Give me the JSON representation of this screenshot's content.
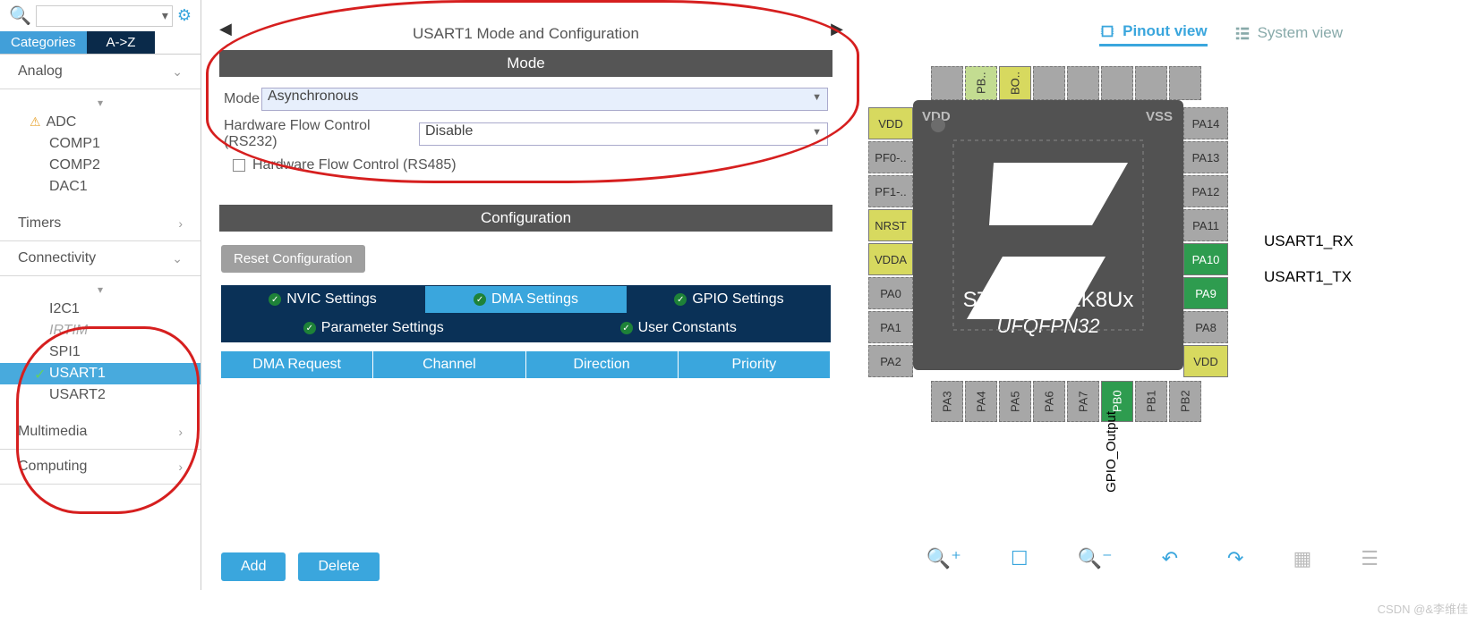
{
  "sidebar": {
    "tabs": {
      "categories": "Categories",
      "az": "A->Z"
    },
    "groups": [
      {
        "name": "Analog",
        "items": [
          "ADC",
          "COMP1",
          "COMP2",
          "DAC1"
        ],
        "open": true
      },
      {
        "name": "Timers",
        "items": [],
        "open": false
      },
      {
        "name": "Connectivity",
        "items": [
          "I2C1",
          "IRTIM",
          "SPI1",
          "USART1",
          "USART2"
        ],
        "open": true
      },
      {
        "name": "Multimedia",
        "items": [],
        "open": false
      },
      {
        "name": "Computing",
        "items": [],
        "open": false
      }
    ]
  },
  "center": {
    "title": "USART1 Mode and Configuration",
    "modeHeader": "Mode",
    "modeLabel": "Mode",
    "modeValue": "Asynchronous",
    "hwLabel": "Hardware Flow Control (RS232)",
    "hwValue": "Disable",
    "chk485": "Hardware Flow Control (RS485)",
    "configHeader": "Configuration",
    "reset": "Reset Configuration",
    "tabs1": [
      "NVIC Settings",
      "DMA Settings",
      "GPIO Settings"
    ],
    "tabs2": [
      "Parameter Settings",
      "User Constants"
    ],
    "dmaCols": [
      "DMA Request",
      "Channel",
      "Direction",
      "Priority"
    ],
    "add": "Add",
    "delete": "Delete"
  },
  "right": {
    "pinout": "Pinout view",
    "system": "System view",
    "chipName": "STM32F051K8Ux",
    "chipPkg": "UFQFPN32",
    "vdd": "VDD",
    "vss": "VSS",
    "leftPins": [
      "VDD",
      "PF0-..",
      "PF1-..",
      "NRST",
      "VDDA",
      "PA0",
      "PA1",
      "PA2"
    ],
    "rightPins": [
      "PA14",
      "PA13",
      "PA12",
      "PA11",
      "PA10",
      "PA9",
      "PA8",
      "VDD"
    ],
    "topPins": [
      "",
      "PB..",
      "BO..",
      "",
      "",
      "",
      "",
      ""
    ],
    "botPins": [
      "PA3",
      "PA4",
      "PA5",
      "PA6",
      "PA7",
      "PB0",
      "PB1",
      "PB2"
    ],
    "usartRx": "USART1_RX",
    "usartTx": "USART1_TX",
    "gpioOut": "GPIO_Output"
  },
  "watermark": "CSDN @&李维佳"
}
